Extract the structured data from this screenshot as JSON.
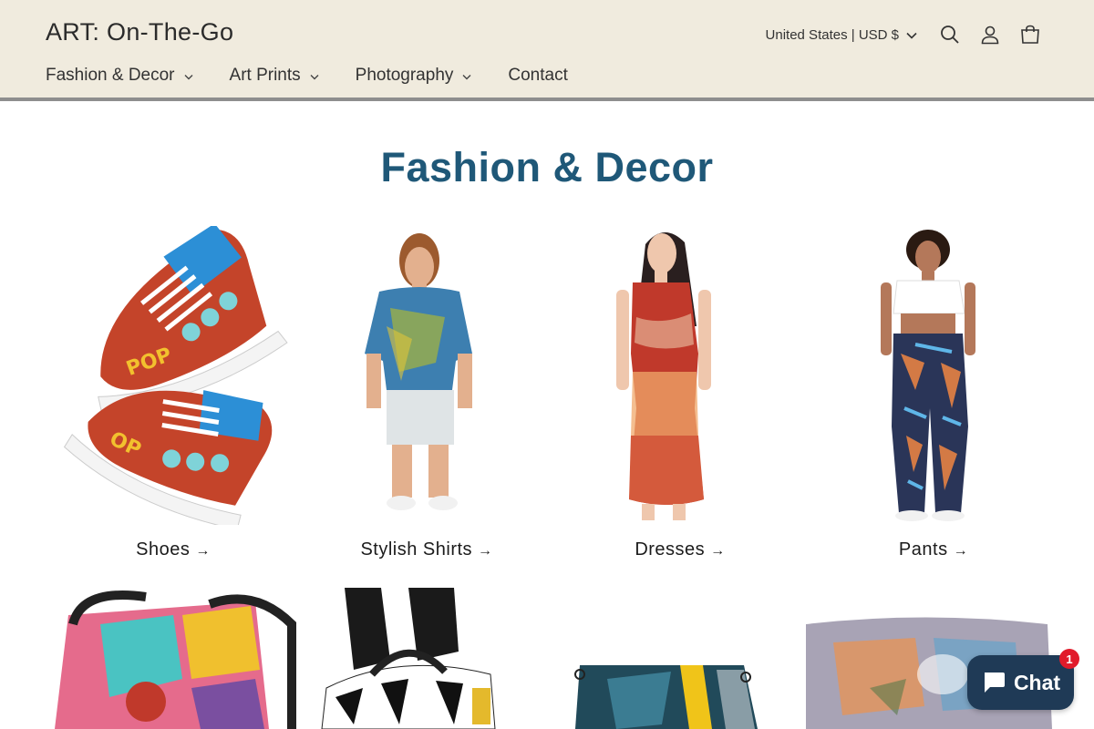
{
  "header": {
    "logo": "ART: On-The-Go",
    "country_selector": "United States | USD $",
    "nav": [
      {
        "label": "Fashion & Decor",
        "has_dropdown": true
      },
      {
        "label": "Art Prints",
        "has_dropdown": true
      },
      {
        "label": "Photography",
        "has_dropdown": true
      },
      {
        "label": "Contact",
        "has_dropdown": false
      }
    ],
    "icons": [
      "search-icon",
      "account-icon",
      "cart-icon"
    ]
  },
  "main": {
    "title": "Fashion & Decor",
    "collections": [
      {
        "label": "Shoes",
        "arrow": "→"
      },
      {
        "label": "Stylish Shirts",
        "arrow": "→"
      },
      {
        "label": "Dresses",
        "arrow": "→"
      },
      {
        "label": "Pants",
        "arrow": "→"
      }
    ]
  },
  "chat": {
    "label": "Chat",
    "badge": "1"
  },
  "colors": {
    "header_bg": "#f0ebde",
    "title": "#1f5878",
    "chat_bg": "#1f3a56",
    "badge": "#e11b2b"
  }
}
